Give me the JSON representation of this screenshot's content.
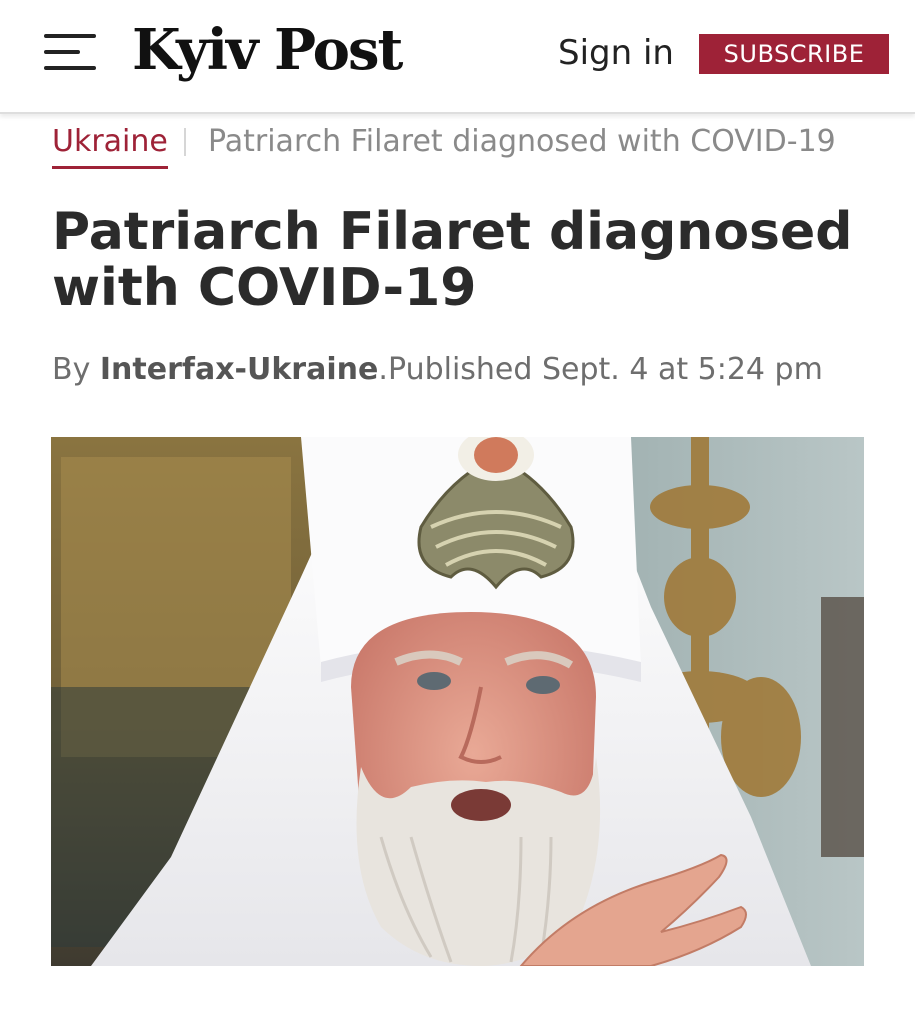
{
  "header": {
    "logo_text": "Kyiv Post",
    "signin_label": "Sign in",
    "subscribe_label": "SUBSCRIBE",
    "brand_color": "#9e2237"
  },
  "breadcrumb": {
    "section": "Ukraine",
    "current": "Patriarch Filaret diagnosed with COVID-19"
  },
  "article": {
    "title": "Patriarch Filaret diagnosed with COVID-19",
    "byline_prefix": "By",
    "author": "Interfax-Ukraine",
    "byline_suffix": ".",
    "published": "Published Sept. 4 at 5:24 pm"
  },
  "icons": {
    "menu": "hamburger-menu-icon"
  }
}
